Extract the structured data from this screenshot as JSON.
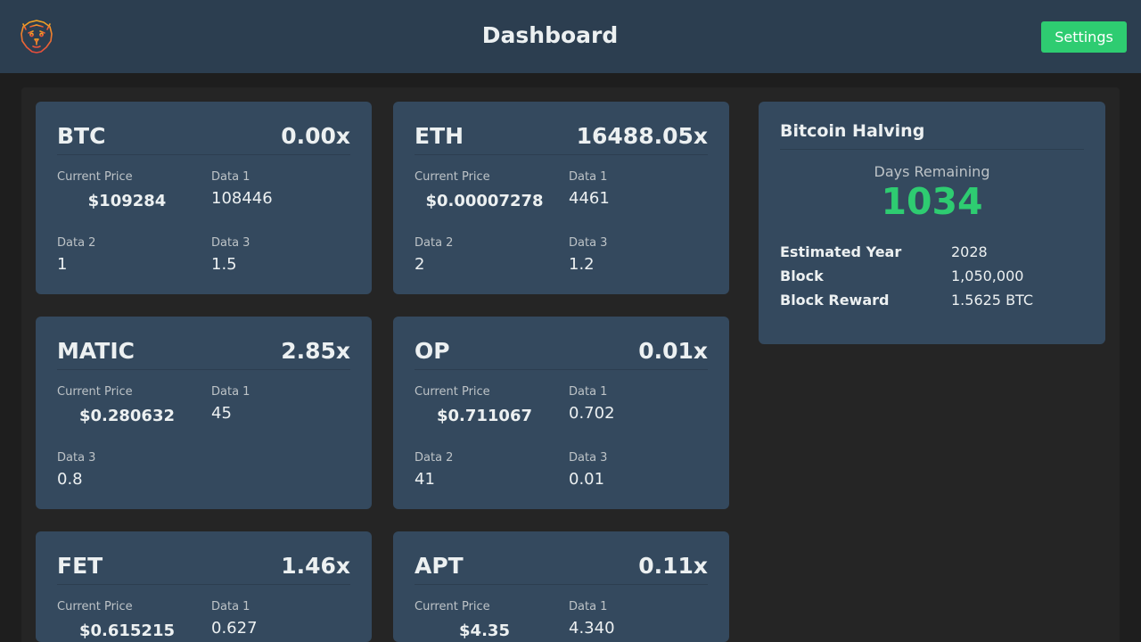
{
  "header": {
    "title": "Dashboard",
    "settings_label": "Settings",
    "logo_icon": "lion-head-icon"
  },
  "colors": {
    "header_bg": "#2c3e50",
    "card_bg": "#34495e",
    "accent": "#2ecc71",
    "page_bg": "#1e1e1e"
  },
  "cards": [
    {
      "symbol": "BTC",
      "multiplier": "0.00x",
      "price_label": "Current Price",
      "price": "$109284",
      "data1_label": "Data 1",
      "data1": "108446",
      "data2_label": "Data 2",
      "data2": "1",
      "data3_label": "Data 3",
      "data3": "1.5"
    },
    {
      "symbol": "ETH",
      "multiplier": "16488.05x",
      "price_label": "Current Price",
      "price": "$0.00007278",
      "data1_label": "Data 1",
      "data1": "4461",
      "data2_label": "Data 2",
      "data2": "2",
      "data3_label": "Data 3",
      "data3": "1.2"
    },
    {
      "symbol": "MATIC",
      "multiplier": "2.85x",
      "price_label": "Current Price",
      "price": "$0.280632",
      "data1_label": "Data 1",
      "data1": "45",
      "data3_label": "Data 3",
      "data3": "0.8"
    },
    {
      "symbol": "OP",
      "multiplier": "0.01x",
      "price_label": "Current Price",
      "price": "$0.711067",
      "data1_label": "Data 1",
      "data1": "0.702",
      "data2_label": "Data 2",
      "data2": "41",
      "data3_label": "Data 3",
      "data3": "0.01"
    },
    {
      "symbol": "FET",
      "multiplier": "1.46x",
      "price_label": "Current Price",
      "price": "$0.615215",
      "data1_label": "Data 1",
      "data1": "0.627"
    },
    {
      "symbol": "APT",
      "multiplier": "0.11x",
      "price_label": "Current Price",
      "price": "$4.35",
      "data1_label": "Data 1",
      "data1": "4.340"
    }
  ],
  "halving": {
    "title": "Bitcoin Halving",
    "days_label": "Days Remaining",
    "days": "1034",
    "estimated_year_label": "Estimated Year",
    "estimated_year": "2028",
    "block_label": "Block",
    "block": "1,050,000",
    "block_reward_label": "Block Reward",
    "block_reward": "1.5625 BTC"
  }
}
